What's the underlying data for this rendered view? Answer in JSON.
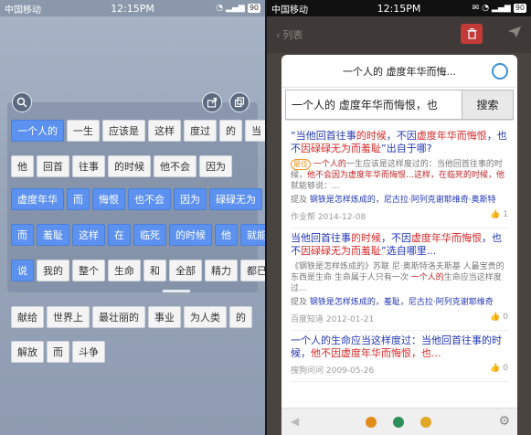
{
  "left": {
    "status": {
      "carrier": "中国移动",
      "time": "12:15PM",
      "battery": "90"
    },
    "rows": [
      [
        {
          "t": "一个人的",
          "s": true
        },
        {
          "t": "一生",
          "s": false
        },
        {
          "t": "应该是",
          "s": false
        },
        {
          "t": "这样",
          "s": false
        },
        {
          "t": "度过",
          "s": false
        },
        {
          "t": "的",
          "s": false
        },
        {
          "t": "当",
          "s": false
        }
      ],
      [
        {
          "t": "他",
          "s": false
        },
        {
          "t": "回首",
          "s": false
        },
        {
          "t": "往事",
          "s": false
        },
        {
          "t": "的时候",
          "s": false
        },
        {
          "t": "他不会",
          "s": false
        },
        {
          "t": "因为",
          "s": false
        }
      ],
      [
        {
          "t": "虚度年华",
          "s": true
        },
        {
          "t": "而",
          "s": true
        },
        {
          "t": "悔恨",
          "s": true
        },
        {
          "t": "也不会",
          "s": true
        },
        {
          "t": "因为",
          "s": true
        },
        {
          "t": "碌碌无为",
          "s": true
        }
      ],
      [
        {
          "t": "而",
          "s": true
        },
        {
          "t": "羞耻",
          "s": true
        },
        {
          "t": "这样",
          "s": true
        },
        {
          "t": "在",
          "s": true
        },
        {
          "t": "临死",
          "s": true
        },
        {
          "t": "的时候",
          "s": true
        },
        {
          "t": "他",
          "s": true
        },
        {
          "t": "就能够",
          "s": true
        }
      ],
      [
        {
          "t": "说",
          "s": true
        },
        {
          "t": "我的",
          "s": false
        },
        {
          "t": "整个",
          "s": false
        },
        {
          "t": "生命",
          "s": false
        },
        {
          "t": "和",
          "s": false
        },
        {
          "t": "全部",
          "s": false
        },
        {
          "t": "精力",
          "s": false
        },
        {
          "t": "都已经",
          "s": false
        }
      ],
      [
        {
          "t": "献给",
          "s": false
        },
        {
          "t": "世界上",
          "s": false
        },
        {
          "t": "最壮丽的",
          "s": false
        },
        {
          "t": "事业",
          "s": false
        },
        {
          "t": "为人类",
          "s": false
        },
        {
          "t": "的",
          "s": false
        }
      ],
      [
        {
          "t": "解放",
          "s": false
        },
        {
          "t": "而",
          "s": false
        },
        {
          "t": "斗争",
          "s": false
        }
      ]
    ]
  },
  "right": {
    "status": {
      "carrier": "中国移动",
      "time": "12:15PM",
      "battery": "90"
    },
    "back_label": "列表",
    "card_title": "一个人的 虚度年华而悔...",
    "search": {
      "value": "一个人的 虚度年华而悔恨，也",
      "button": "搜索"
    },
    "results": [
      {
        "title_parts": [
          {
            "t": "“当他回首往事",
            "h": false
          },
          {
            "t": "的时候",
            "h": true
          },
          {
            "t": "，不因",
            "h": false
          },
          {
            "t": "虚度年华而悔恨",
            "h": true
          },
          {
            "t": "，也不",
            "h": false
          },
          {
            "t": "因碌碌无为而羞耻",
            "h": true
          },
          {
            "t": "”出自于哪?",
            "h": false
          }
        ],
        "badge": "最佳",
        "body_parts": [
          {
            "t": " 一个人的",
            "e": true
          },
          {
            "t": "一生应该是这样度过的：当他回首往事的时候，",
            "e": false
          },
          {
            "t": "他不会因为虚度年华而悔恨",
            "e": true
          },
          {
            "t": "…这样，在临死的时候，他",
            "e": true
          },
          {
            "t": "就能够说：...",
            "e": false
          }
        ],
        "link_prefix": "提及",
        "link": "钢铁是怎样炼成的，尼古拉·阿列克谢耶维奇·奥斯特",
        "source": "作业帮",
        "date": "2014-12-08",
        "likes": "1"
      },
      {
        "title_parts": [
          {
            "t": "当他回首往事",
            "h": false
          },
          {
            "t": "的时候",
            "h": true
          },
          {
            "t": "，不因",
            "h": false
          },
          {
            "t": "虚度年华而悔恨",
            "h": true
          },
          {
            "t": "，也不",
            "h": false
          },
          {
            "t": "因碌碌无为而羞耻",
            "h": true
          },
          {
            "t": "”选自哪里...",
            "h": false
          }
        ],
        "badge": "",
        "body_parts": [
          {
            "t": "《钢铁是怎样炼成的》苏联 尼·奥斯特洛夫斯基 人最宝贵的东西是生命 生命属于人只有一次 ",
            "e": false
          },
          {
            "t": "一个人的",
            "e": true
          },
          {
            "t": "生命应当这样度过...",
            "e": false
          }
        ],
        "link_prefix": "提及",
        "link": "钢铁是怎样炼成的，羞耻，尼古拉·阿列克谢耶维奇",
        "source": "百度知道",
        "date": "2012-01-21",
        "likes": "0"
      },
      {
        "title_parts": [
          {
            "t": "一个人的生命应当这样度过：当他回首往事的时候，",
            "h": false
          },
          {
            "t": "他不因虚度年华而悔恨，也...",
            "h": true
          }
        ],
        "badge": "",
        "body_parts": [],
        "link_prefix": "",
        "link": "",
        "source": "搜狗问问",
        "date": "2009-05-26",
        "likes": "0"
      }
    ]
  },
  "colors": {
    "chip_selected": "#5c91ef",
    "link_blue": "#2338b5",
    "highlight_red": "#d62a2a",
    "trash_red": "#c23b38"
  }
}
